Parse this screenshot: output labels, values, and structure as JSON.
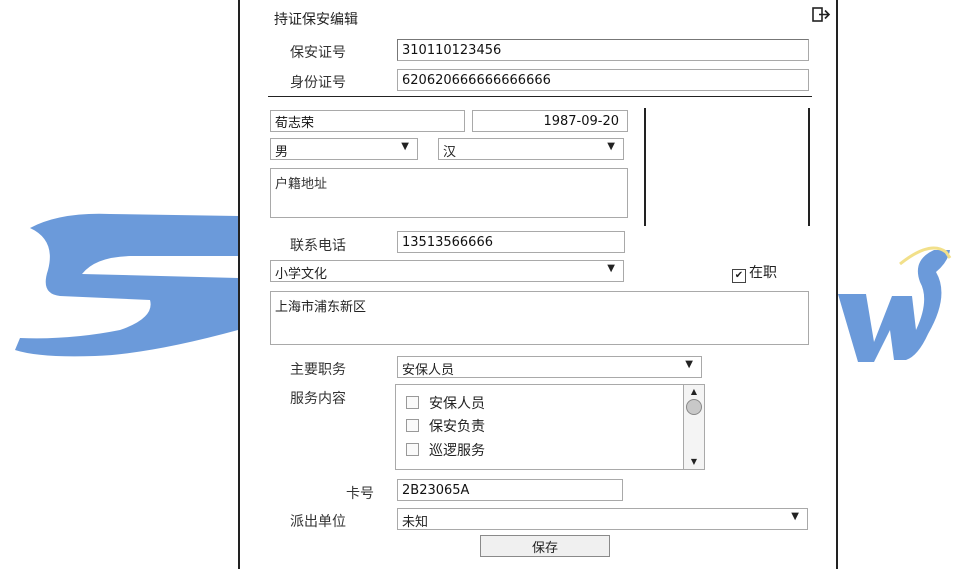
{
  "form": {
    "title": "持证保安编辑",
    "exit_icon": "exit-icon",
    "license_label": "保安证号",
    "license_value": "310110123456",
    "id_label": "身份证号",
    "id_value": "620620666666666666",
    "name_value": "荀志荣",
    "birthdate_value": "1987-09-20",
    "gender_value": "男",
    "ethnicity_value": "汉",
    "address_placeholder": "户籍地址",
    "phone_label": "联系电话",
    "phone_value": "13513566666",
    "education_value": "小学文化",
    "employed_label": "在职",
    "employed_checked": true,
    "residence_value": "上海市浦东新区",
    "duty_label": "主要职务",
    "duty_value": "安保人员",
    "service_label": "服务内容",
    "services": [
      "安保人员",
      "保安负责",
      "巡逻服务"
    ],
    "card_label": "卡号",
    "card_value": "2B23065A",
    "unit_label": "派出单位",
    "unit_value": "未知",
    "save_label": "保存"
  },
  "colors": {
    "watermark": "#5b8fd6",
    "watermark_outline": "#f2e08a"
  }
}
